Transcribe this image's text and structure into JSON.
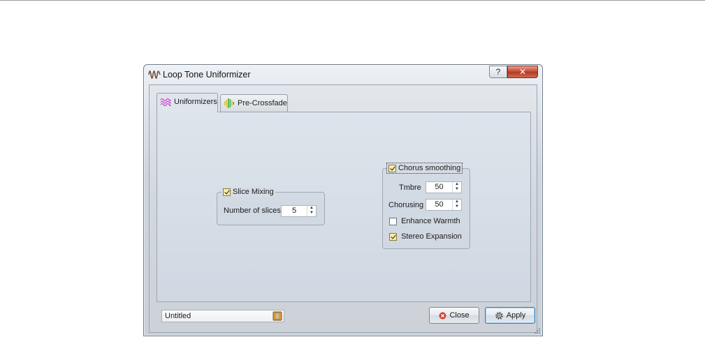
{
  "window": {
    "title": "Loop Tone Uniformizer",
    "help_glyph": "?",
    "close_glyph": "✕",
    "icon": "waveform-icon"
  },
  "tabs": [
    {
      "label": "Uniformizers",
      "icon": "wave-lines-icon",
      "active": true
    },
    {
      "label": "Pre-Crossfade",
      "icon": "crossfade-bars-icon",
      "active": false
    }
  ],
  "slice_mixing": {
    "label": "Slice Mixing",
    "checked": true,
    "slices_label": "Number of slices",
    "slices_value": "5"
  },
  "chorus": {
    "label": "Chorus smoothing",
    "checked": true,
    "timbre_label": "Tmbre",
    "timbre_value": "50",
    "chorusing_label": "Chorusing",
    "chorusing_value": "50",
    "enhance_warmth_label": "Enhance Warmth",
    "enhance_warmth_checked": false,
    "stereo_expansion_label": "Stereo Expansion",
    "stereo_expansion_checked": true
  },
  "footer": {
    "preset_name": "Untitled",
    "close_label": "Close",
    "apply_label": "Apply"
  },
  "colors": {
    "accent_magenta": "#d43fd4",
    "crossfade_yellow": "#d8c62a",
    "crossfade_green": "#3fae3a",
    "close_red": "#d23c2a",
    "check_fill": "#fbe9a8"
  }
}
